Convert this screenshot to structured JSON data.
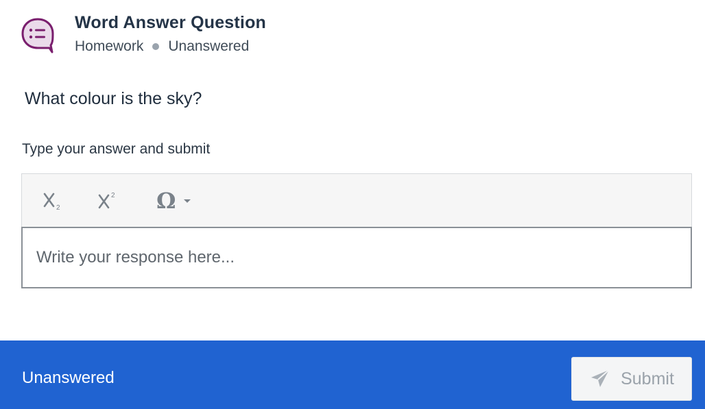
{
  "header": {
    "title": "Word Answer Question",
    "category": "Homework",
    "status": "Unanswered",
    "icon": "speech-bubble-list-icon"
  },
  "question": {
    "text": "What colour is the sky?"
  },
  "answer": {
    "instructions": "Type your answer and submit",
    "toolbar": [
      {
        "name": "subscript",
        "icon": "subscript-icon"
      },
      {
        "name": "superscript",
        "icon": "superscript-icon"
      },
      {
        "name": "special-characters",
        "icon": "omega-icon"
      }
    ],
    "placeholder": "Write your response here...",
    "value": ""
  },
  "footer": {
    "status": "Unanswered",
    "submit_label": "Submit",
    "submit_icon": "paper-plane-icon"
  },
  "colors": {
    "accent_purple": "#7a1f6e",
    "footer_blue": "#2063d1",
    "text_dark": "#243447"
  }
}
